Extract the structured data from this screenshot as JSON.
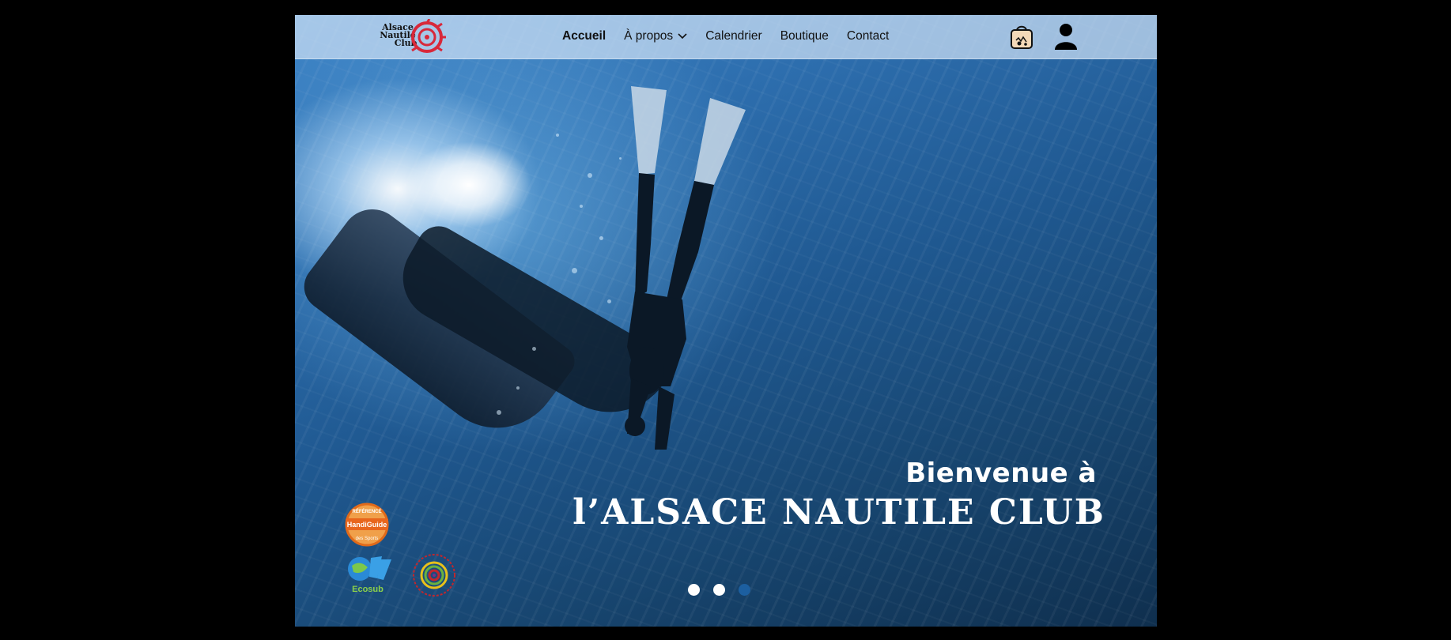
{
  "logo": {
    "line1": "Alsace",
    "line2": "Nautile",
    "line3": "Club"
  },
  "nav": {
    "items": [
      {
        "label": "Accueil",
        "active": true
      },
      {
        "label": "À propos",
        "dropdown": true
      },
      {
        "label": "Calendrier"
      },
      {
        "label": "Boutique"
      },
      {
        "label": "Contact"
      }
    ]
  },
  "header_icons": {
    "cart": "shopping-bag-icon",
    "account": "user-icon"
  },
  "hero": {
    "line1": "Bienvenue à",
    "line2": "l’ALSACE NAUTILE CLUB"
  },
  "badges": {
    "handiguide": {
      "top": "RÉFÉRENCÉ",
      "middle": "HandiGuide",
      "bottom": "des Sports"
    },
    "ecosub": "Ecosub",
    "third": "label-badge"
  },
  "carousel": {
    "total": 3,
    "active_index": 2
  },
  "colors": {
    "nav_bg": "#cde1f5",
    "active_dot": "#1c5fa0",
    "hero_text": "#ffffff"
  }
}
